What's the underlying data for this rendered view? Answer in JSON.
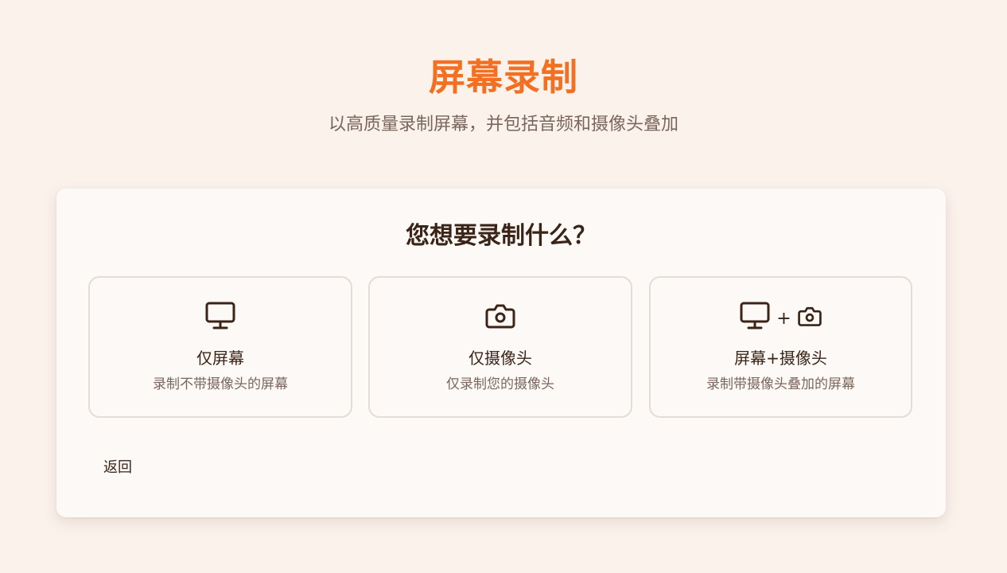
{
  "header": {
    "title": "屏幕录制",
    "subtitle": "以高质量录制屏幕，并包括音频和摄像头叠加"
  },
  "card": {
    "question": "您想要录制什么？",
    "options": [
      {
        "icon": "monitor-icon",
        "title": "仅屏幕",
        "description": "录制不带摄像头的屏幕"
      },
      {
        "icon": "camera-icon",
        "title": "仅摄像头",
        "description": "仅录制您的摄像头"
      },
      {
        "icon": "monitor-camera-icon",
        "title": "屏幕+摄像头",
        "description": "录制带摄像头叠加的屏幕",
        "plus": "+"
      }
    ],
    "back_label": "返回"
  },
  "colors": {
    "accent": "#f36f21",
    "background": "#fbf2ec",
    "card": "#fdf9f6",
    "text": "#3a2418",
    "muted": "#7a665c",
    "border": "#e4dcd7"
  }
}
